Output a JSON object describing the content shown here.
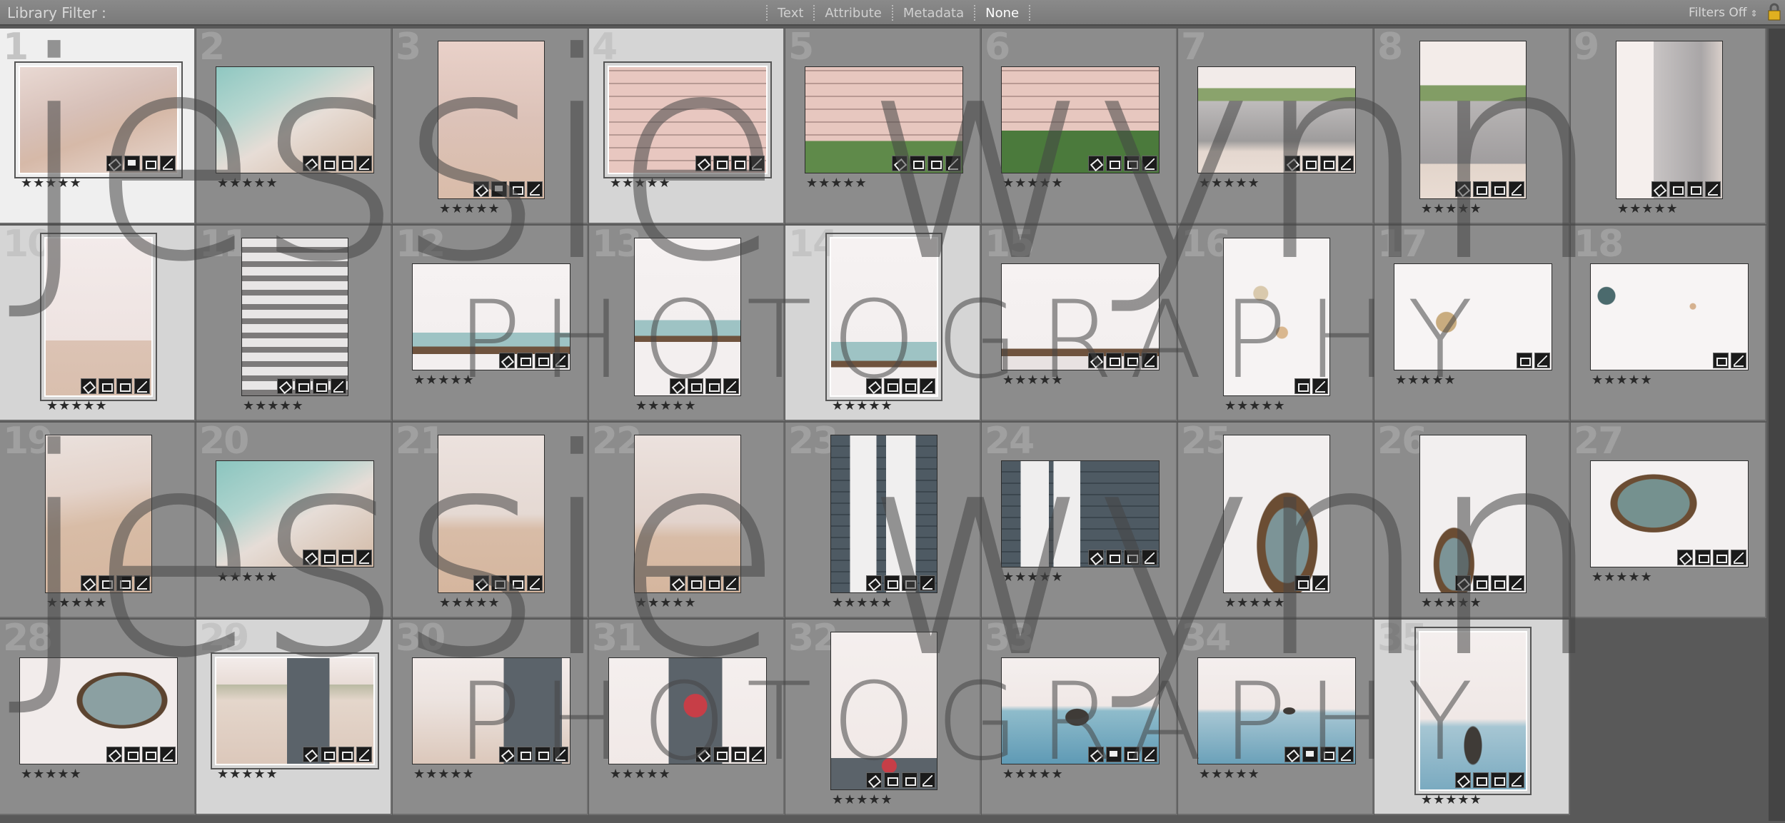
{
  "filter_bar": {
    "title": "Library Filter :",
    "tabs": [
      "Text",
      "Attribute",
      "Metadata",
      "None"
    ],
    "active_tab": "None",
    "filters_status": "Filters Off",
    "filters_arrow": "⇕"
  },
  "watermark": {
    "script_text_top": "jessie wynn",
    "caps_text_top": "PHOTOGRAPHY",
    "script_text_bottom": "jessie wynn",
    "caps_text_bottom": "PHOTOGRAPHY"
  },
  "colors": {
    "accent_selected": "#d5d5d5",
    "primary_selected": "#efefef",
    "cell": "#8c8c8c"
  },
  "photos": [
    {
      "num": "1",
      "stars": "★★★★★",
      "orient": "l",
      "sel": "primary",
      "bg": "linear-gradient(160deg,#e9d9d3 0%,#d7c0b8 40%,#d6b9a8 60%,#e9d9d1 100%)",
      "badges": [
        "tag",
        "comment",
        "crop",
        "edit"
      ]
    },
    {
      "num": "2",
      "stars": "★★★★★",
      "orient": "l",
      "sel": "",
      "bg": "linear-gradient(150deg,#8fc7c1 0%,#b5d6cf 30%,#e7ddd6 55%,#d3b9a5 100%)",
      "badges": [
        "tag",
        "crop",
        "crop",
        "edit"
      ]
    },
    {
      "num": "3",
      "stars": "★★★★★",
      "orient": "p",
      "sel": "",
      "bg": "linear-gradient(180deg,#e9d1c9 0%,#dcc2b8 50%,#d9bca9 100%)",
      "badges": [
        "tag",
        "comment",
        "crop",
        "edit"
      ]
    },
    {
      "num": "4",
      "stars": "★★★★★",
      "orient": "l",
      "sel": "sel",
      "bg": "repeating-linear-gradient(0deg,#e8c7c0 0px,#e8c7c0 16px,#b79a94 16px,#b79a94 18px)",
      "badges": [
        "tag",
        "crop",
        "crop",
        "edit"
      ]
    },
    {
      "num": "5",
      "stars": "★★★★★",
      "orient": "l",
      "sel": "",
      "bg": "linear-gradient(180deg,rgba(0,0,0,0) 70%,#5f8a4a 70%),repeating-linear-gradient(0deg,#e7c7bf 0px,#e7c7bf 16px,#b89993 16px,#b89993 18px)",
      "badges": [
        "tag",
        "crop",
        "crop",
        "edit"
      ]
    },
    {
      "num": "6",
      "stars": "★★★★★",
      "orient": "l",
      "sel": "",
      "bg": "linear-gradient(180deg,rgba(0,0,0,0) 60%,#4b7a3c 60%),repeating-linear-gradient(0deg,#e7c7bf 0px,#e7c7bf 16px,#b89993 16px,#b89993 18px)",
      "badges": [
        "tag",
        "crop",
        "crop",
        "edit"
      ]
    },
    {
      "num": "7",
      "stars": "★★★★★",
      "orient": "l",
      "sel": "",
      "bg": "linear-gradient(180deg,#f2ebe9 0%,#f2ebe9 20%,#8aa36c 20%,#8aa36c 32%,#bfbcbc 32%,#9e9c9c 70%,#e4d7cf 80%,#e9ddd5 100%)",
      "badges": [
        "tag",
        "crop",
        "crop",
        "edit"
      ]
    },
    {
      "num": "8",
      "stars": "★★★★★",
      "orient": "p",
      "sel": "",
      "bg": "linear-gradient(180deg,#f3ece9 0%,#f3ece9 28%,#829d65 28%,#829d65 38%,#b8b5b5 38%,#a09d9e 78%,#e3d5cb 78%,#e9dcd3 100%)",
      "badges": [
        "tag",
        "crop",
        "crop",
        "edit"
      ]
    },
    {
      "num": "9",
      "stars": "★★★★★",
      "orient": "p",
      "sel": "",
      "bg": "linear-gradient(90deg,#f5efed 0%,#f5efed 35%,#c8c4c4 35%,#a9a6a7 80%,#d9cfca 100%)",
      "badges": [
        "tag",
        "crop",
        "crop",
        "edit"
      ]
    },
    {
      "num": "10",
      "stars": "★★★★★",
      "orient": "p",
      "sel": "sel",
      "bg": "linear-gradient(180deg,#f3ebea 0%,#eee3e1 65%,#dcc3b4 65%,#d9bfae 100%)",
      "badges": [
        "tag",
        "crop",
        "crop",
        "edit"
      ]
    },
    {
      "num": "11",
      "stars": "★★★★★",
      "orient": "p",
      "sel": "",
      "bg": "repeating-linear-gradient(180deg,#e8e6e6 0px,#e8e6e6 12px,#7c7a7a 12px,#7c7a7a 20px)",
      "badges": [
        "tag",
        "crop",
        "crop",
        "edit"
      ]
    },
    {
      "num": "12",
      "stars": "★★★★★",
      "orient": "l",
      "sel": "",
      "bg": "linear-gradient(180deg,#f6f2f2 0%,#f3efef 65%,#9ec3c4 65%,#9ec3c4 78%,#6f533e 78%,#6f533e 85%,#f3efef 85%)",
      "badges": [
        "tag",
        "crop",
        "crop",
        "edit"
      ]
    },
    {
      "num": "13",
      "stars": "★★★★★",
      "orient": "p",
      "sel": "",
      "bg": "linear-gradient(180deg,#f6f2f2 0%,#f3efef 52%,#9ec3c4 52%,#9ec3c4 62%,#6f533e 62%,#6f533e 66%,#f3efef 66%)",
      "badges": [
        "tag",
        "crop",
        "crop",
        "edit"
      ]
    },
    {
      "num": "14",
      "stars": "★★★★★",
      "orient": "p",
      "sel": "sel",
      "bg": "linear-gradient(180deg,#f6f2f2 0%,#f3efef 66%,#9ec3c4 66%,#9ec3c4 78%,#6f533e 78%,#6f533e 82%,#f3efef 82%)",
      "badges": [
        "tag",
        "crop",
        "crop",
        "edit"
      ]
    },
    {
      "num": "15",
      "stars": "★★★★★",
      "orient": "l",
      "sel": "",
      "bg": "linear-gradient(180deg,#f6f2f2 0%,#f3efef 80%,#6f533e 80%,#6f533e 87%,#e8e2e2 87%)",
      "badges": [
        "tag",
        "crop",
        "crop",
        "edit"
      ]
    },
    {
      "num": "16",
      "stars": "★★★★★",
      "orient": "p",
      "sel": "",
      "bg": "radial-gradient(circle at 55% 60%,#d9b78f 0 8px,transparent 9px),radial-gradient(circle at 35% 35%,#d9c9ad 0 10px,transparent 11px),#f6f3f3",
      "badges": [
        "crop",
        "edit"
      ]
    },
    {
      "num": "17",
      "stars": "★★★★★",
      "orient": "l",
      "sel": "",
      "bg": "radial-gradient(circle at 33% 55%,#c9ac7f 0 14px,transparent 15px),#f7f4f4",
      "badges": [
        "crop",
        "edit"
      ]
    },
    {
      "num": "18",
      "stars": "★★★★★",
      "orient": "l",
      "sel": "",
      "bg": "radial-gradient(circle at 10% 30%,#4b6a6d 0 12px,transparent 13px),radial-gradient(circle at 65% 40%,#d5b18f 0 4px,transparent 5px),#f7f4f4",
      "badges": [
        "crop",
        "edit"
      ]
    },
    {
      "num": "19",
      "stars": "★★★★★",
      "orient": "p",
      "sel": "",
      "bg": "linear-gradient(170deg,#eae1dd 0%,#e4d3ca 35%,#d8bca6 55%,#d4b69f 100%)",
      "badges": [
        "tag",
        "crop",
        "crop",
        "edit"
      ]
    },
    {
      "num": "20",
      "stars": "★★★★★",
      "orient": "l",
      "sel": "",
      "bg": "linear-gradient(150deg,#8bc5bf 0%,#aed3cd 32%,#e6ddd7 55%,#d2b9a5 100%)",
      "badges": [
        "tag",
        "crop",
        "crop",
        "edit"
      ]
    },
    {
      "num": "21",
      "stars": "★★★★★",
      "orient": "p",
      "sel": "",
      "bg": "linear-gradient(180deg,#ece2de 0%,#e5d9d3 50%,#d8bca7 60%,#d5b69e 100%)",
      "badges": [
        "tag",
        "crop",
        "crop",
        "edit"
      ]
    },
    {
      "num": "22",
      "stars": "★★★★★",
      "orient": "p",
      "sel": "",
      "bg": "linear-gradient(180deg,#ece2de 0%,#e2d3cc 55%,#d8bca7 65%,#d5b69e 100%)",
      "badges": [
        "tag",
        "crop",
        "crop",
        "edit"
      ]
    },
    {
      "num": "23",
      "stars": "★★★★★",
      "orient": "p",
      "sel": "",
      "bg": "linear-gradient(90deg,transparent 18%,#f0efef 18%,#f0efef 43%,transparent 43%,transparent 52%,#f0efef 52%,#f0efef 80%,transparent 80%),repeating-linear-gradient(180deg,#4e5a63 0px,#4e5a63 14px,#3b464e 14px,#3b464e 16px)",
      "badges": [
        "tag",
        "crop",
        "crop",
        "edit"
      ]
    },
    {
      "num": "24",
      "stars": "★★★★★",
      "orient": "l",
      "sel": "",
      "bg": "linear-gradient(90deg,transparent 12%,#efeeee 12%,#efeeee 30%,transparent 30%,transparent 33%,#efeeee 33%,#efeeee 50%,transparent 50%),repeating-linear-gradient(180deg,#4e5a63 0px,#4e5a63 14px,#3b464e 14px,#3b464e 16px)",
      "badges": [
        "tag",
        "crop",
        "crop",
        "edit"
      ]
    },
    {
      "num": "25",
      "stars": "★★★★★",
      "orient": "p",
      "sel": "",
      "bg": "radial-gradient(ellipse at 60% 70%,#7c9497 0 30px,#6b4d33 31px 42px,transparent 43px),#f2efef",
      "badges": [
        "crop",
        "edit"
      ]
    },
    {
      "num": "26",
      "stars": "★★★★★",
      "orient": "p",
      "sel": "",
      "bg": "radial-gradient(ellipse at 32% 82%,#7c9497 0 20px,#6b4d33 21px 28px,transparent 29px),#f2efef",
      "badges": [
        "tag",
        "crop",
        "crop",
        "edit"
      ]
    },
    {
      "num": "27",
      "stars": "★★★★★",
      "orient": "l",
      "sel": "",
      "bg": "radial-gradient(ellipse at 40% 40%,#75918f 0 50px,#6b4d33 51px 60px,transparent 61px),#f4f1f1",
      "badges": [
        "tag",
        "crop",
        "crop",
        "edit"
      ]
    },
    {
      "num": "28",
      "stars": "★★★★★",
      "orient": "l",
      "sel": "",
      "bg": "radial-gradient(ellipse at 65% 40%,#8ba0a2 0 55px,#5c4430 56px 63px,transparent 64px),#f2eceb",
      "badges": [
        "tag",
        "crop",
        "crop",
        "edit"
      ]
    },
    {
      "num": "29",
      "stars": "★★★★★",
      "orient": "l",
      "sel": "sel",
      "bg": "linear-gradient(90deg,transparent 45%,#5b636a 45%,#5b636a 72%,transparent 72%),linear-gradient(180deg,#f3ecea 0%,#e8dcd6 25%,#b9b9a2 25%,#e4d6cb 40%,#dcc8bb 100%)",
      "badges": [
        "tag",
        "crop",
        "crop",
        "edit"
      ]
    },
    {
      "num": "30",
      "stars": "★★★★★",
      "orient": "l",
      "sel": "",
      "bg": "linear-gradient(90deg,transparent 58%,#5b636a 58%,#5b636a 95%,transparent 95%),linear-gradient(180deg,#f3ecea 0%,#ece3df 40%,#dcc8bb 100%)",
      "badges": [
        "tag",
        "crop",
        "crop",
        "edit"
      ]
    },
    {
      "num": "31",
      "stars": "★★★★★",
      "orient": "l",
      "sel": "",
      "bg": "radial-gradient(circle at 55% 45%,#c73e47 0 16px,transparent 17px),linear-gradient(90deg,transparent 38%,#5b636a 38%,#5b636a 72%,transparent 72%),linear-gradient(180deg,#f4efee 0%,#f1e9e7 100%)",
      "badges": [
        "tag",
        "crop",
        "crop",
        "edit"
      ]
    },
    {
      "num": "32",
      "stars": "★★★★★",
      "orient": "p",
      "sel": "",
      "bg": "radial-gradient(circle at 55% 85%,#c73e47 0 10px,transparent 11px),linear-gradient(180deg,#f4efee 0%,#f1e9e7 80%,#5b636a 80%)",
      "badges": [
        "tag",
        "crop",
        "crop",
        "edit"
      ]
    },
    {
      "num": "33",
      "stars": "★★★★★",
      "orient": "l",
      "sel": "",
      "bg": "radial-gradient(ellipse at 48% 56%,#3f3b37 0 16px,transparent 17px),linear-gradient(180deg,#f4efee 0%,#f0e8e6 45%,#8fbccb 50%,#5f9ab5 100%)",
      "badges": [
        "tag",
        "comment",
        "crop",
        "edit"
      ]
    },
    {
      "num": "34",
      "stars": "★★★★★",
      "orient": "l",
      "sel": "",
      "bg": "radial-gradient(ellipse at 58% 50%,#3f3b37 0 8px,transparent 9px),linear-gradient(180deg,#f4efee 0%,#f0e8e6 48%,#a6c6d3 52%,#6ba1b9 100%)",
      "badges": [
        "tag",
        "comment",
        "crop",
        "edit"
      ]
    },
    {
      "num": "35",
      "stars": "★★★★★",
      "orient": "p",
      "sel": "sel",
      "bg": "radial-gradient(ellipse at 50% 72%,#3f3b37 0 12px,transparent 13px),linear-gradient(180deg,#f4efee 0%,#f0e8e6 55%,#a6c6d3 60%,#7aaac0 100%)",
      "badges": [
        "tag",
        "crop",
        "crop",
        "edit"
      ]
    }
  ]
}
